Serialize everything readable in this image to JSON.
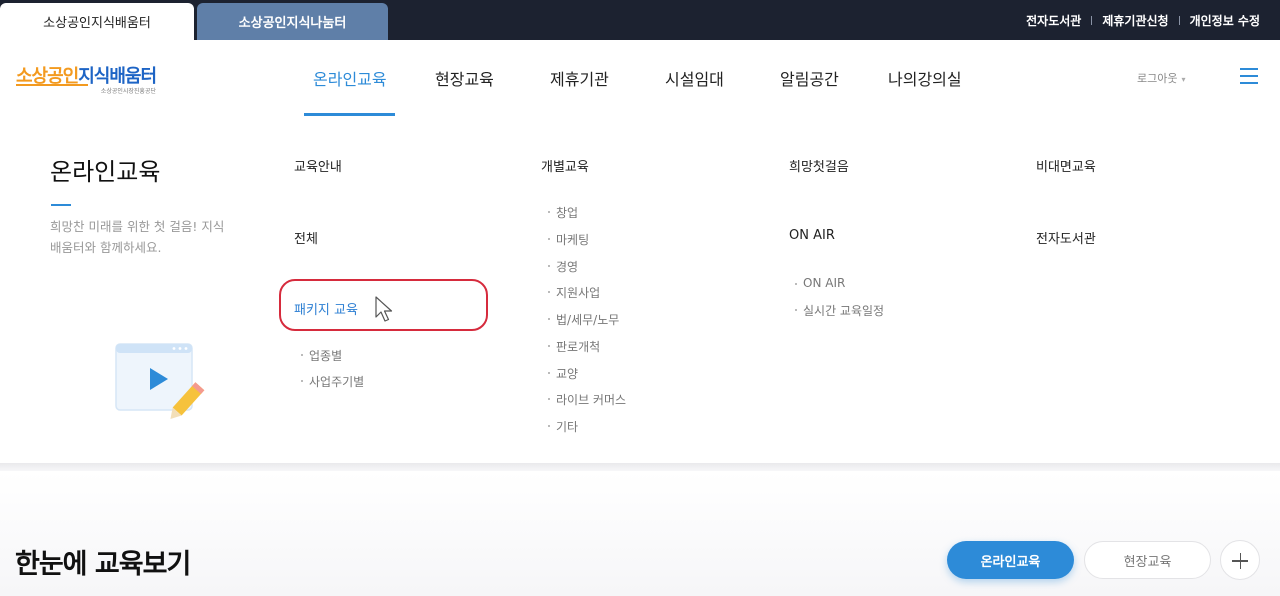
{
  "top_bar": {
    "site_tabs": [
      {
        "label": "소상공인지식배움터",
        "active": true
      },
      {
        "label": "소상공인지식나눔터",
        "active": false
      }
    ],
    "links": [
      "전자도서관",
      "제휴기관신청",
      "개인정보 수정"
    ]
  },
  "header": {
    "logo": {
      "main_orange": "소상공인",
      "main_blue": "지식배움터",
      "sub": "소상공인시장진흥공단"
    },
    "nav": [
      "온라인교육",
      "현장교육",
      "제휴기관",
      "시설임대",
      "알림공간",
      "나의강의실"
    ],
    "active_nav": "온라인교육",
    "logout_label": "로그아웃",
    "menu_icon": "hamburger-icon"
  },
  "dropdown": {
    "title": "온라인교육",
    "description": "희망찬 미래를 위한 첫 걸음! 지식배움터와 함께하세요.",
    "columns": [
      {
        "items": [
          {
            "label": "교육안내",
            "subs": []
          },
          {
            "label": "전체",
            "subs": []
          },
          {
            "label": "패키지 교육",
            "subs": [
              "업종별",
              "사업주기별"
            ]
          }
        ]
      },
      {
        "items": [
          {
            "label": "개별교육",
            "subs": [
              "창업",
              "마케팅",
              "경영",
              "지원사업",
              "법/세무/노무",
              "판로개척",
              "교양",
              "라이브 커머스",
              "기타"
            ]
          }
        ]
      },
      {
        "items": [
          {
            "label": "희망첫걸음",
            "subs": []
          },
          {
            "label": "ON AIR",
            "subs": [
              "ON AIR",
              "실시간 교육일정"
            ]
          }
        ]
      },
      {
        "items": [
          {
            "label": "비대면교육",
            "subs": []
          },
          {
            "label": "전자도서관",
            "subs": []
          }
        ]
      }
    ],
    "highlighted_item": "패키지 교육"
  },
  "section": {
    "title": "한눈에 교육보기",
    "tabs": [
      "온라인교육",
      "현장교육"
    ],
    "active_tab": "온라인교육",
    "more_icon": "plus-icon"
  },
  "colors": {
    "accent": "#2d8bd8",
    "topbar": "#1c2230",
    "inactive_tab": "#5f7fa8",
    "logo_orange": "#f39a1f",
    "logo_blue": "#1d64c5",
    "highlight_red": "#d62b3d"
  }
}
